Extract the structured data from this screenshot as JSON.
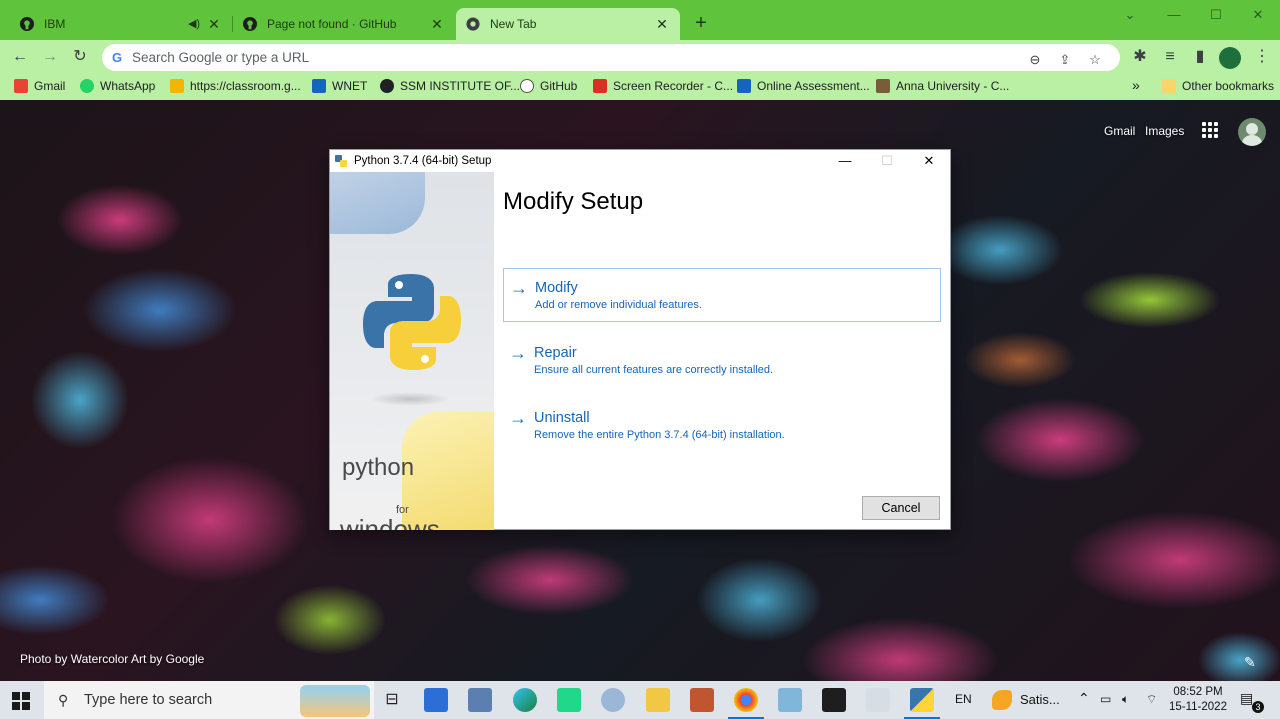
{
  "browser": {
    "tabs": [
      {
        "title": "IBM",
        "icon": "github-icon"
      },
      {
        "title": "Page not found · GitHub",
        "icon": "github-icon"
      },
      {
        "title": "New Tab",
        "icon": "chrome-icon"
      }
    ],
    "omnibox_placeholder": "Search Google or type a URL",
    "bookmarks": [
      {
        "label": "Gmail",
        "color": "#ea4335"
      },
      {
        "label": "WhatsApp",
        "color": "#25d366"
      },
      {
        "label": "https://classroom.g...",
        "color": "#f4b400"
      },
      {
        "label": "WNET",
        "color": "#1565c0"
      },
      {
        "label": "SSM INSTITUTE OF...",
        "color": "#202124"
      },
      {
        "label": "GitHub",
        "color": "#ffffff"
      },
      {
        "label": "Screen Recorder - C...",
        "color": "#d93025"
      },
      {
        "label": "Online Assessment...",
        "color": "#1565c0"
      },
      {
        "label": "Anna University - C...",
        "color": "#7a5b3a"
      }
    ],
    "other_bookmarks": "Other bookmarks",
    "overflow": "»"
  },
  "newtab": {
    "gmail": "Gmail",
    "images": "Images",
    "photo_credit": "Photo by Watercolor Art by Google"
  },
  "dialog": {
    "title": "Python 3.7.4 (64-bit) Setup",
    "heading": "Modify Setup",
    "options": [
      {
        "title": "Modify",
        "description": "Add or remove individual features."
      },
      {
        "title": "Repair",
        "description": "Ensure all current features are correctly installed."
      },
      {
        "title": "Uninstall",
        "description": "Remove the entire Python 3.7.4 (64-bit) installation."
      }
    ],
    "banner_line1": "python",
    "banner_line2": "for",
    "banner_line3": "windows",
    "cancel": "Cancel"
  },
  "taskbar": {
    "search_placeholder": "Type here to search",
    "language": "EN",
    "app_label": "Satis...",
    "time": "08:52 PM",
    "date": "15-11-2022",
    "notification_count": "3"
  },
  "colors": {
    "chrome_green": "#5fc43c",
    "chrome_light": "#b9f0a3",
    "link_blue": "#1565b8"
  }
}
